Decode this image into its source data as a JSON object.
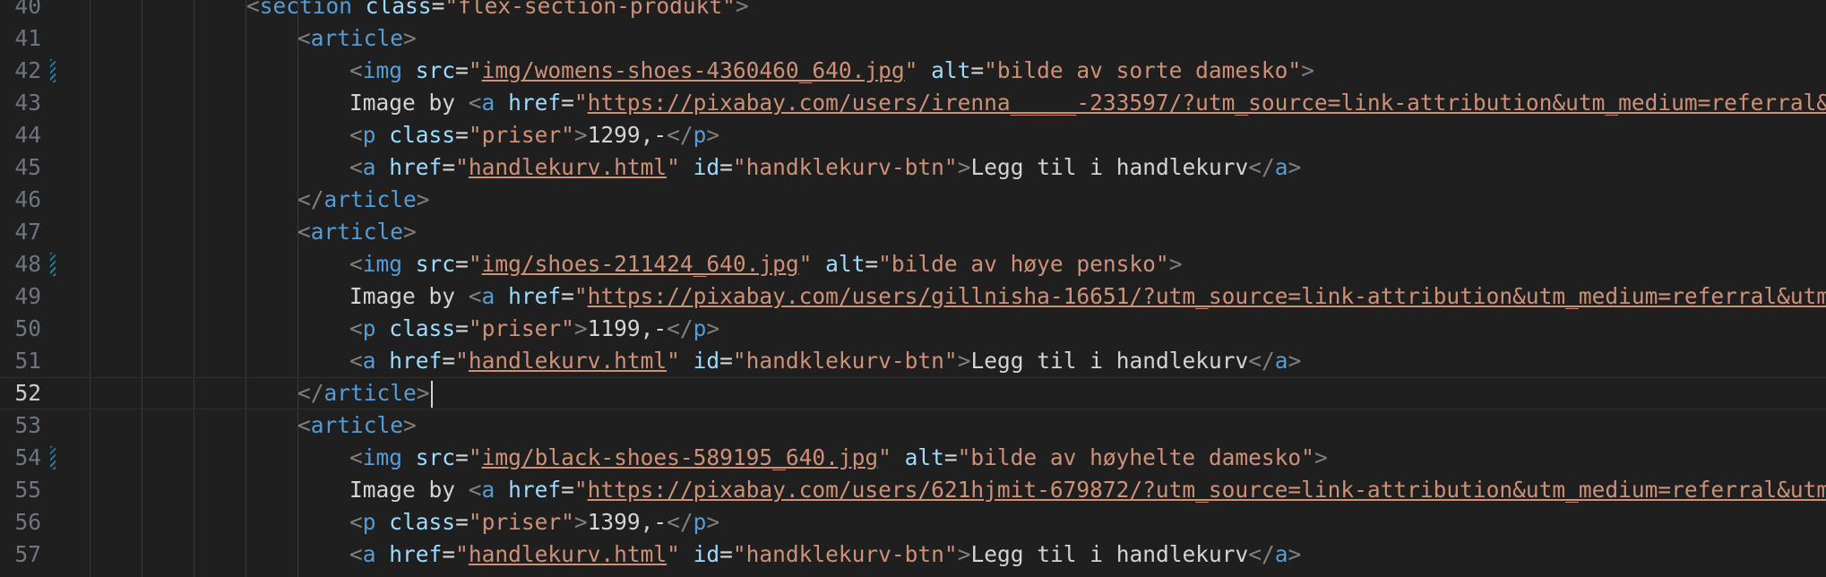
{
  "editor": {
    "lines": [
      {
        "num": "40",
        "parts": [
          {
            "t": "<",
            "c": "br"
          },
          {
            "t": "section",
            "c": "tag"
          },
          {
            "t": " ",
            "c": "txt"
          },
          {
            "t": "class",
            "c": "attr"
          },
          {
            "t": "=",
            "c": "txt"
          },
          {
            "t": "\"flex-section-produkt\"",
            "c": "str"
          },
          {
            "t": ">",
            "c": "br"
          }
        ]
      },
      {
        "num": "41",
        "parts": [
          {
            "t": "<",
            "c": "br"
          },
          {
            "t": "article",
            "c": "tag"
          },
          {
            "t": ">",
            "c": "br"
          }
        ]
      },
      {
        "num": "42",
        "mark": true,
        "parts": [
          {
            "t": "<",
            "c": "br"
          },
          {
            "t": "img",
            "c": "tag"
          },
          {
            "t": " ",
            "c": "txt"
          },
          {
            "t": "src",
            "c": "attr"
          },
          {
            "t": "=",
            "c": "txt"
          },
          {
            "t": "\"",
            "c": "str"
          },
          {
            "t": "img/womens-shoes-4360460_640.jpg",
            "c": "str link"
          },
          {
            "t": "\"",
            "c": "str"
          },
          {
            "t": " ",
            "c": "txt"
          },
          {
            "t": "alt",
            "c": "attr"
          },
          {
            "t": "=",
            "c": "txt"
          },
          {
            "t": "\"bilde av sorte damesko\"",
            "c": "str"
          },
          {
            "t": ">",
            "c": "br"
          }
        ]
      },
      {
        "num": "43",
        "parts": [
          {
            "t": "Image by ",
            "c": "txt"
          },
          {
            "t": "<",
            "c": "br"
          },
          {
            "t": "a",
            "c": "tag"
          },
          {
            "t": " ",
            "c": "txt"
          },
          {
            "t": "href",
            "c": "attr"
          },
          {
            "t": "=",
            "c": "txt"
          },
          {
            "t": "\"",
            "c": "str"
          },
          {
            "t": "https://pixabay.com/users/irenna_____-233597/?utm_source=link-attribution&utm_medium=referral&utm_ca",
            "c": "str link"
          }
        ]
      },
      {
        "num": "44",
        "parts": [
          {
            "t": "<",
            "c": "br"
          },
          {
            "t": "p",
            "c": "tag"
          },
          {
            "t": " ",
            "c": "txt"
          },
          {
            "t": "class",
            "c": "attr"
          },
          {
            "t": "=",
            "c": "txt"
          },
          {
            "t": "\"priser\"",
            "c": "str"
          },
          {
            "t": ">",
            "c": "br"
          },
          {
            "t": "1299,-",
            "c": "txt"
          },
          {
            "t": "</",
            "c": "br"
          },
          {
            "t": "p",
            "c": "tag"
          },
          {
            "t": ">",
            "c": "br"
          }
        ]
      },
      {
        "num": "45",
        "parts": [
          {
            "t": "<",
            "c": "br"
          },
          {
            "t": "a",
            "c": "tag"
          },
          {
            "t": " ",
            "c": "txt"
          },
          {
            "t": "href",
            "c": "attr"
          },
          {
            "t": "=",
            "c": "txt"
          },
          {
            "t": "\"",
            "c": "str"
          },
          {
            "t": "handlekurv.html",
            "c": "str link"
          },
          {
            "t": "\"",
            "c": "str"
          },
          {
            "t": " ",
            "c": "txt"
          },
          {
            "t": "id",
            "c": "attr"
          },
          {
            "t": "=",
            "c": "txt"
          },
          {
            "t": "\"handklekurv-btn\"",
            "c": "str"
          },
          {
            "t": ">",
            "c": "br"
          },
          {
            "t": "Legg til i handlekurv",
            "c": "txt"
          },
          {
            "t": "</",
            "c": "br"
          },
          {
            "t": "a",
            "c": "tag"
          },
          {
            "t": ">",
            "c": "br"
          }
        ]
      },
      {
        "num": "46",
        "parts": [
          {
            "t": "</",
            "c": "br"
          },
          {
            "t": "article",
            "c": "tag"
          },
          {
            "t": ">",
            "c": "br"
          }
        ]
      },
      {
        "num": "47",
        "parts": [
          {
            "t": "<",
            "c": "br"
          },
          {
            "t": "article",
            "c": "tag"
          },
          {
            "t": ">",
            "c": "br"
          }
        ]
      },
      {
        "num": "48",
        "mark": true,
        "parts": [
          {
            "t": "<",
            "c": "br"
          },
          {
            "t": "img",
            "c": "tag"
          },
          {
            "t": " ",
            "c": "txt"
          },
          {
            "t": "src",
            "c": "attr"
          },
          {
            "t": "=",
            "c": "txt"
          },
          {
            "t": "\"",
            "c": "str"
          },
          {
            "t": "img/shoes-211424_640.jpg",
            "c": "str link"
          },
          {
            "t": "\"",
            "c": "str"
          },
          {
            "t": " ",
            "c": "txt"
          },
          {
            "t": "alt",
            "c": "attr"
          },
          {
            "t": "=",
            "c": "txt"
          },
          {
            "t": "\"bilde av høye pensko\"",
            "c": "str"
          },
          {
            "t": ">",
            "c": "br"
          }
        ]
      },
      {
        "num": "49",
        "parts": [
          {
            "t": "Image by ",
            "c": "txt"
          },
          {
            "t": "<",
            "c": "br"
          },
          {
            "t": "a",
            "c": "tag"
          },
          {
            "t": " ",
            "c": "txt"
          },
          {
            "t": "href",
            "c": "attr"
          },
          {
            "t": "=",
            "c": "txt"
          },
          {
            "t": "\"",
            "c": "str"
          },
          {
            "t": "https://pixabay.com/users/gillnisha-16651/?utm_source=link-attribution&utm_medium=referral&utm_ca",
            "c": "str link"
          }
        ]
      },
      {
        "num": "50",
        "parts": [
          {
            "t": "<",
            "c": "br"
          },
          {
            "t": "p",
            "c": "tag"
          },
          {
            "t": " ",
            "c": "txt"
          },
          {
            "t": "class",
            "c": "attr"
          },
          {
            "t": "=",
            "c": "txt"
          },
          {
            "t": "\"priser\"",
            "c": "str"
          },
          {
            "t": ">",
            "c": "br"
          },
          {
            "t": "1199,-",
            "c": "txt"
          },
          {
            "t": "</",
            "c": "br"
          },
          {
            "t": "p",
            "c": "tag"
          },
          {
            "t": ">",
            "c": "br"
          }
        ]
      },
      {
        "num": "51",
        "parts": [
          {
            "t": "<",
            "c": "br"
          },
          {
            "t": "a",
            "c": "tag"
          },
          {
            "t": " ",
            "c": "txt"
          },
          {
            "t": "href",
            "c": "attr"
          },
          {
            "t": "=",
            "c": "txt"
          },
          {
            "t": "\"",
            "c": "str"
          },
          {
            "t": "handlekurv.html",
            "c": "str link"
          },
          {
            "t": "\"",
            "c": "str"
          },
          {
            "t": " ",
            "c": "txt"
          },
          {
            "t": "id",
            "c": "attr"
          },
          {
            "t": "=",
            "c": "txt"
          },
          {
            "t": "\"handklekurv-btn\"",
            "c": "str"
          },
          {
            "t": ">",
            "c": "br"
          },
          {
            "t": "Legg til i handlekurv",
            "c": "txt"
          },
          {
            "t": "</",
            "c": "br"
          },
          {
            "t": "a",
            "c": "tag"
          },
          {
            "t": ">",
            "c": "br"
          }
        ]
      },
      {
        "num": "52",
        "current": true,
        "parts": [
          {
            "t": "</",
            "c": "br"
          },
          {
            "t": "article",
            "c": "tag"
          },
          {
            "t": ">",
            "c": "br"
          }
        ]
      },
      {
        "num": "53",
        "parts": [
          {
            "t": "<",
            "c": "br"
          },
          {
            "t": "article",
            "c": "tag"
          },
          {
            "t": ">",
            "c": "br"
          }
        ]
      },
      {
        "num": "54",
        "mark": true,
        "parts": [
          {
            "t": "<",
            "c": "br"
          },
          {
            "t": "img",
            "c": "tag"
          },
          {
            "t": " ",
            "c": "txt"
          },
          {
            "t": "src",
            "c": "attr"
          },
          {
            "t": "=",
            "c": "txt"
          },
          {
            "t": "\"",
            "c": "str"
          },
          {
            "t": "img/black-shoes-589195_640.jpg",
            "c": "str link"
          },
          {
            "t": "\"",
            "c": "str"
          },
          {
            "t": " ",
            "c": "txt"
          },
          {
            "t": "alt",
            "c": "attr"
          },
          {
            "t": "=",
            "c": "txt"
          },
          {
            "t": "\"bilde av høyhelte damesko\"",
            "c": "str"
          },
          {
            "t": ">",
            "c": "br"
          }
        ]
      },
      {
        "num": "55",
        "parts": [
          {
            "t": "Image by ",
            "c": "txt"
          },
          {
            "t": "<",
            "c": "br"
          },
          {
            "t": "a",
            "c": "tag"
          },
          {
            "t": " ",
            "c": "txt"
          },
          {
            "t": "href",
            "c": "attr"
          },
          {
            "t": "=",
            "c": "txt"
          },
          {
            "t": "\"",
            "c": "str"
          },
          {
            "t": "https://pixabay.com/users/621hjmit-679872/?utm_source=link-attribution&utm_medium=referral&utm_ca",
            "c": "str link"
          }
        ]
      },
      {
        "num": "56",
        "parts": [
          {
            "t": "<",
            "c": "br"
          },
          {
            "t": "p",
            "c": "tag"
          },
          {
            "t": " ",
            "c": "txt"
          },
          {
            "t": "class",
            "c": "attr"
          },
          {
            "t": "=",
            "c": "txt"
          },
          {
            "t": "\"priser\"",
            "c": "str"
          },
          {
            "t": ">",
            "c": "br"
          },
          {
            "t": "1399,-",
            "c": "txt"
          },
          {
            "t": "</",
            "c": "br"
          },
          {
            "t": "p",
            "c": "tag"
          },
          {
            "t": ">",
            "c": "br"
          }
        ]
      },
      {
        "num": "57",
        "parts": [
          {
            "t": "<",
            "c": "br"
          },
          {
            "t": "a",
            "c": "tag"
          },
          {
            "t": " ",
            "c": "txt"
          },
          {
            "t": "href",
            "c": "attr"
          },
          {
            "t": "=",
            "c": "txt"
          },
          {
            "t": "\"",
            "c": "str"
          },
          {
            "t": "handlekurv.html",
            "c": "str link"
          },
          {
            "t": "\"",
            "c": "str"
          },
          {
            "t": " ",
            "c": "txt"
          },
          {
            "t": "id",
            "c": "attr"
          },
          {
            "t": "=",
            "c": "txt"
          },
          {
            "t": "\"handklekurv-btn\"",
            "c": "str"
          },
          {
            "t": ">",
            "c": "br"
          },
          {
            "t": "Legg til i handlekurv",
            "c": "txt"
          },
          {
            "t": "</",
            "c": "br"
          },
          {
            "t": "a",
            "c": "tag"
          },
          {
            "t": ">",
            "c": "br"
          }
        ]
      }
    ]
  }
}
